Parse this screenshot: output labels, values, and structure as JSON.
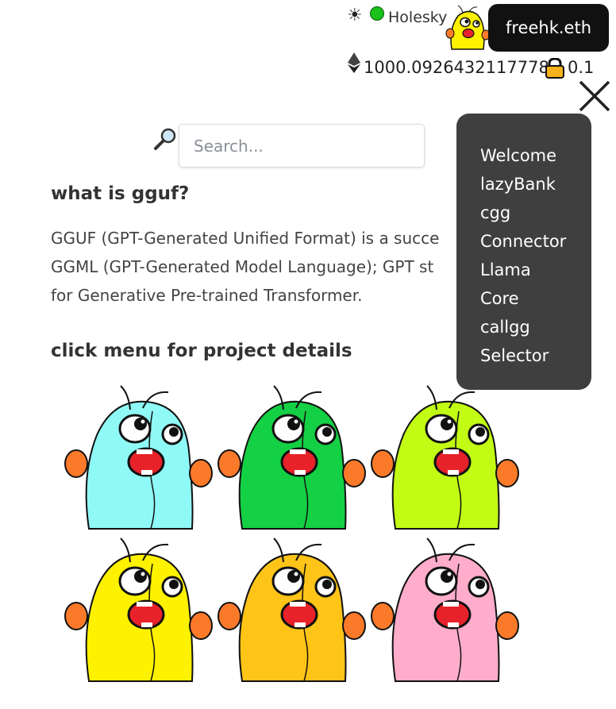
{
  "header": {
    "theme_icon": "sun-icon",
    "network": {
      "name": "Holesky",
      "status_color": "#1ac21a"
    },
    "ens_button": "freehk.eth",
    "balance": "1000.0926432117778",
    "locked_value": "0.1",
    "close_icon": "close-x-icon"
  },
  "search": {
    "placeholder": "Search...",
    "value": "",
    "icon": "magnifier-icon"
  },
  "content": {
    "heading_what": "what is gguf?",
    "paragraph_lines": [
      "GGUF (GPT-Generated Unified Format) is a succe",
      "GGML (GPT-Generated Model Language); GPT st",
      "for Generative Pre-trained Transformer."
    ],
    "heading_click": "click menu for project details"
  },
  "menu": {
    "items": [
      "Welcome",
      "lazyBank",
      "cgg",
      "Connector",
      "Llama",
      "Core",
      "callgg",
      "Selector"
    ]
  },
  "mascots": [
    {
      "name": "cyan-gg",
      "color": "#8ff9f6"
    },
    {
      "name": "green-gg",
      "color": "#14d044"
    },
    {
      "name": "lime-gg",
      "color": "#c2fb14"
    },
    {
      "name": "yellow-gg",
      "color": "#fff200"
    },
    {
      "name": "amber-gg",
      "color": "#fec418"
    },
    {
      "name": "pink-gg",
      "color": "#ffadca"
    }
  ]
}
